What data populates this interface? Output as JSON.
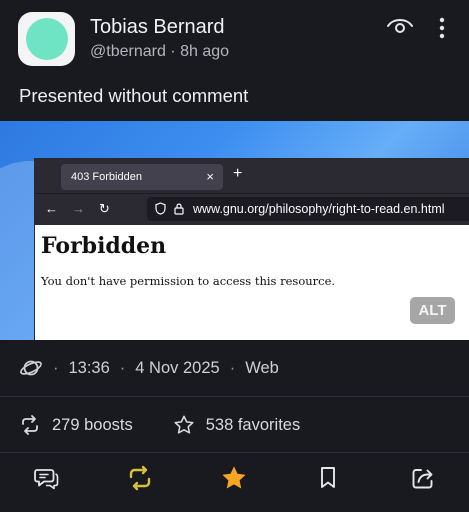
{
  "author": {
    "name": "Tobias Bernard",
    "handle": "@tbernard",
    "time_sep": "·",
    "age": "8h ago"
  },
  "post": {
    "text": "Presented without comment",
    "media_alt_label": "ALT"
  },
  "screenshot": {
    "tab_title": "403 Forbidden",
    "tab_close": "×",
    "new_tab": "+",
    "nav_back": "←",
    "nav_forward": "→",
    "nav_reload": "↻",
    "url": "www.gnu.org/philosophy/right-to-read.en.html",
    "heading": "Forbidden",
    "message": "You don't have permission to access this resource."
  },
  "meta": {
    "sep": "·",
    "time": "13:36",
    "date": "4 Nov 2025",
    "client": "Web"
  },
  "stats": {
    "boosts": "279 boosts",
    "favorites": "538 favorites"
  },
  "icons": {
    "visibility": "eye-icon",
    "more": "more-vertical-icon",
    "globe": "globe-icon",
    "boost": "boost-icon",
    "favorite": "star-icon",
    "reply": "reply-icon",
    "bookmark": "bookmark-icon",
    "share": "share-icon"
  },
  "colors": {
    "background": "#181a20",
    "boosted": "#d6c23a",
    "favorited": "#f5a623",
    "avatar": "#6ee4c4"
  }
}
